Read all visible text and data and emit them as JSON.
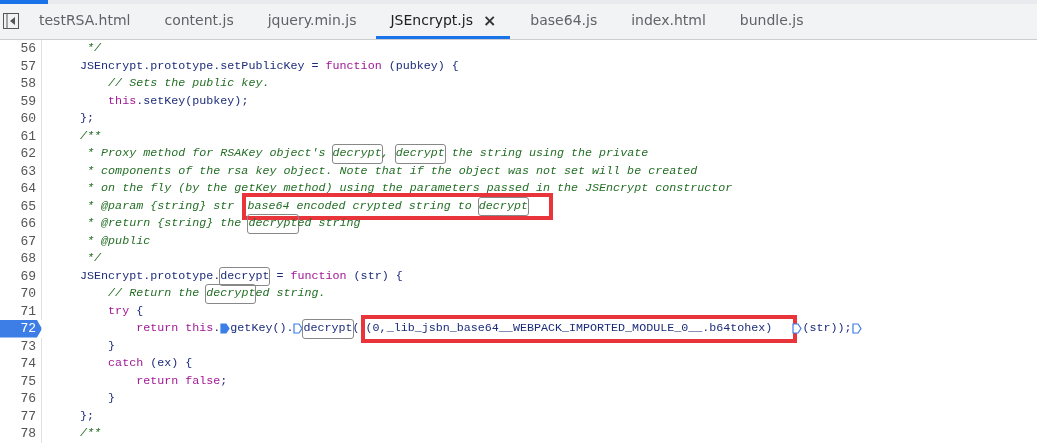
{
  "tabs": [
    {
      "label": "testRSA.html",
      "selected": false
    },
    {
      "label": "content.js",
      "selected": false
    },
    {
      "label": "jquery.min.js",
      "selected": false
    },
    {
      "label": "JSEncrypt.js",
      "selected": true,
      "close": "×"
    },
    {
      "label": "base64.js",
      "selected": false
    },
    {
      "label": "index.html",
      "selected": false
    },
    {
      "label": "bundle.js",
      "selected": false
    }
  ],
  "lines": [
    {
      "number": "56",
      "breakpoint": false,
      "tokens": [
        {
          "kind": "comment",
          "text": "     */"
        }
      ]
    },
    {
      "number": "57",
      "breakpoint": false,
      "tokens": [
        {
          "kind": "plain",
          "text": "    JSEncrypt.prototype.setPublicKey = "
        },
        {
          "kind": "keyword",
          "text": "function"
        },
        {
          "kind": "plain",
          "text": " (pubkey) {"
        }
      ]
    },
    {
      "number": "58",
      "breakpoint": false,
      "tokens": [
        {
          "kind": "comment",
          "text": "        // Sets the public key."
        }
      ]
    },
    {
      "number": "59",
      "breakpoint": false,
      "tokens": [
        {
          "kind": "keyword",
          "text": "        this"
        },
        {
          "kind": "plain",
          "text": ".setKey(pubkey);"
        }
      ]
    },
    {
      "number": "60",
      "breakpoint": false,
      "tokens": [
        {
          "kind": "plain",
          "text": "    };"
        }
      ]
    },
    {
      "number": "61",
      "breakpoint": false,
      "tokens": [
        {
          "kind": "comment",
          "text": "    /**"
        }
      ]
    },
    {
      "number": "62",
      "breakpoint": false,
      "tokens": [
        {
          "kind": "comment",
          "text": "     * Proxy method for RSAKey object's "
        },
        {
          "kind": "comment",
          "text": "decrypt",
          "match": true
        },
        {
          "kind": "comment",
          "text": ", "
        },
        {
          "kind": "comment",
          "text": "decrypt",
          "match": true
        },
        {
          "kind": "comment",
          "text": " the string using the private"
        }
      ]
    },
    {
      "number": "63",
      "breakpoint": false,
      "tokens": [
        {
          "kind": "comment",
          "text": "     * components of the rsa key object. Note that if the object was not set will be created"
        }
      ]
    },
    {
      "number": "64",
      "breakpoint": false,
      "tokens": [
        {
          "kind": "comment",
          "text": "     * on the fly (by the getKey method) using the parameters passed in the JSEncrypt constructor"
        }
      ]
    },
    {
      "number": "65",
      "breakpoint": false,
      "tokens": [
        {
          "kind": "comment",
          "text": "     * @param {string} str "
        },
        {
          "kind": "annotation",
          "tokens": [
            {
              "kind": "comment",
              "text": "base64 encoded crypted string to "
            },
            {
              "kind": "comment",
              "text": "decrypt",
              "match": true
            }
          ]
        }
      ]
    },
    {
      "number": "66",
      "breakpoint": false,
      "tokens": [
        {
          "kind": "comment",
          "text": "     * @return {string} the "
        },
        {
          "kind": "comment",
          "text": "decrypt",
          "match": true
        },
        {
          "kind": "comment",
          "text": "ed string"
        }
      ]
    },
    {
      "number": "67",
      "breakpoint": false,
      "tokens": [
        {
          "kind": "comment",
          "text": "     * @public"
        }
      ]
    },
    {
      "number": "68",
      "breakpoint": false,
      "tokens": [
        {
          "kind": "comment",
          "text": "     */"
        }
      ]
    },
    {
      "number": "69",
      "breakpoint": false,
      "tokens": [
        {
          "kind": "plain",
          "text": "    JSEncrypt.prototype."
        },
        {
          "kind": "plain",
          "text": "decrypt",
          "match": true
        },
        {
          "kind": "plain",
          "text": " = "
        },
        {
          "kind": "keyword",
          "text": "function"
        },
        {
          "kind": "plain",
          "text": " (str) {"
        }
      ]
    },
    {
      "number": "70",
      "breakpoint": false,
      "tokens": [
        {
          "kind": "comment",
          "text": "        // Return the "
        },
        {
          "kind": "comment",
          "text": "decrypt",
          "match": true
        },
        {
          "kind": "comment",
          "text": "ed string."
        }
      ]
    },
    {
      "number": "71",
      "breakpoint": false,
      "tokens": [
        {
          "kind": "keyword",
          "text": "        try"
        },
        {
          "kind": "plain",
          "text": " {"
        }
      ]
    },
    {
      "number": "72",
      "breakpoint": true,
      "tokens": [
        {
          "kind": "keyword",
          "text": "            return this"
        },
        {
          "kind": "plain",
          "text": "."
        },
        {
          "kind": "marker",
          "active": true
        },
        {
          "kind": "plain",
          "text": "getKey()."
        },
        {
          "kind": "marker",
          "active": false
        },
        {
          "kind": "plain",
          "text": "decrypt",
          "match": true
        },
        {
          "kind": "plain",
          "text": "("
        },
        {
          "kind": "annotation",
          "tokens": [
            {
              "kind": "plain",
              "text": "(0,_lib_jsbn_base64__WEBPACK_IMPORTED_MODULE_0__.b64tohex)"
            }
          ]
        },
        {
          "kind": "marker",
          "active": false
        },
        {
          "kind": "plain",
          "text": "(str));"
        },
        {
          "kind": "marker",
          "active": false
        }
      ]
    },
    {
      "number": "73",
      "breakpoint": false,
      "tokens": [
        {
          "kind": "plain",
          "text": "        }"
        }
      ]
    },
    {
      "number": "74",
      "breakpoint": false,
      "tokens": [
        {
          "kind": "keyword",
          "text": "        catch"
        },
        {
          "kind": "plain",
          "text": " (ex) {"
        }
      ]
    },
    {
      "number": "75",
      "breakpoint": false,
      "tokens": [
        {
          "kind": "keyword",
          "text": "            return false"
        },
        {
          "kind": "plain",
          "text": ";"
        }
      ]
    },
    {
      "number": "76",
      "breakpoint": false,
      "tokens": [
        {
          "kind": "plain",
          "text": "        }"
        }
      ]
    },
    {
      "number": "77",
      "breakpoint": false,
      "tokens": [
        {
          "kind": "plain",
          "text": "    };"
        }
      ]
    },
    {
      "number": "78",
      "breakpoint": false,
      "tokens": [
        {
          "kind": "comment",
          "text": "    /**"
        }
      ]
    }
  ]
}
